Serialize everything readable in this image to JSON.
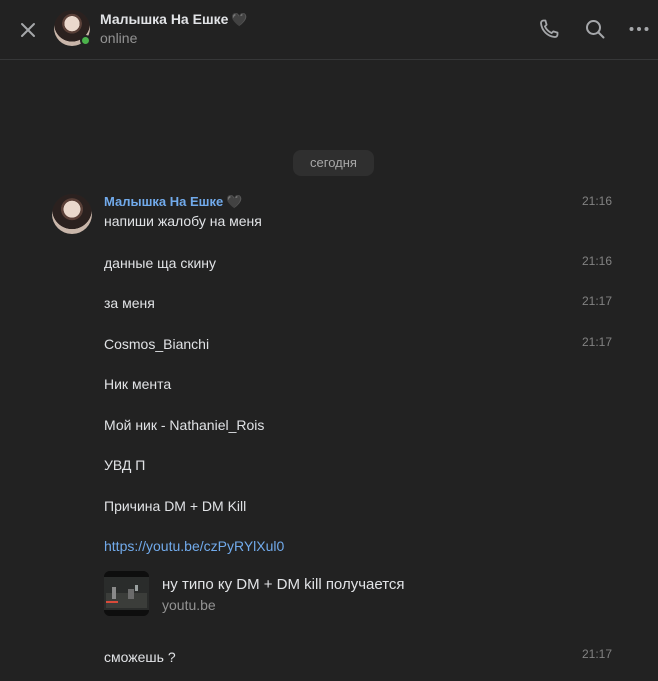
{
  "header": {
    "title": "Малышка На Ешке",
    "title_emoji": "🖤",
    "status": "online",
    "close_icon": "close-icon",
    "call_icon": "phone-icon",
    "search_icon": "search-icon",
    "more_icon": "more-icon"
  },
  "date_divider": "сегодня",
  "sender": {
    "name": "Малышка На Ешке",
    "emoji": "🖤"
  },
  "messages": [
    {
      "text": "напиши жалобу на меня",
      "time": "21:16"
    },
    {
      "text": "данные ща скину",
      "time": "21:16"
    },
    {
      "text": "за меня",
      "time": "21:17"
    },
    {
      "text": "Cosmos_Bianchi",
      "time": "21:17"
    },
    {
      "text": "Ник мента",
      "time": ""
    },
    {
      "text": "Мой ник - Nathaniel_Rois",
      "time": ""
    },
    {
      "text": "УВД П",
      "time": ""
    },
    {
      "text": "Причина DM + DM Kill",
      "time": ""
    },
    {
      "text": "https://youtu.be/czPyRYlXul0",
      "time": ""
    },
    {
      "text": "сможешь ?",
      "time": "21:17"
    }
  ],
  "link_preview": {
    "title": "ну типо ку DM + DM kill получается",
    "domain": "youtu.be"
  },
  "colors": {
    "background": "#222222",
    "accent": "#71aaeb",
    "online": "#4bb34b",
    "muted": "#828282"
  }
}
